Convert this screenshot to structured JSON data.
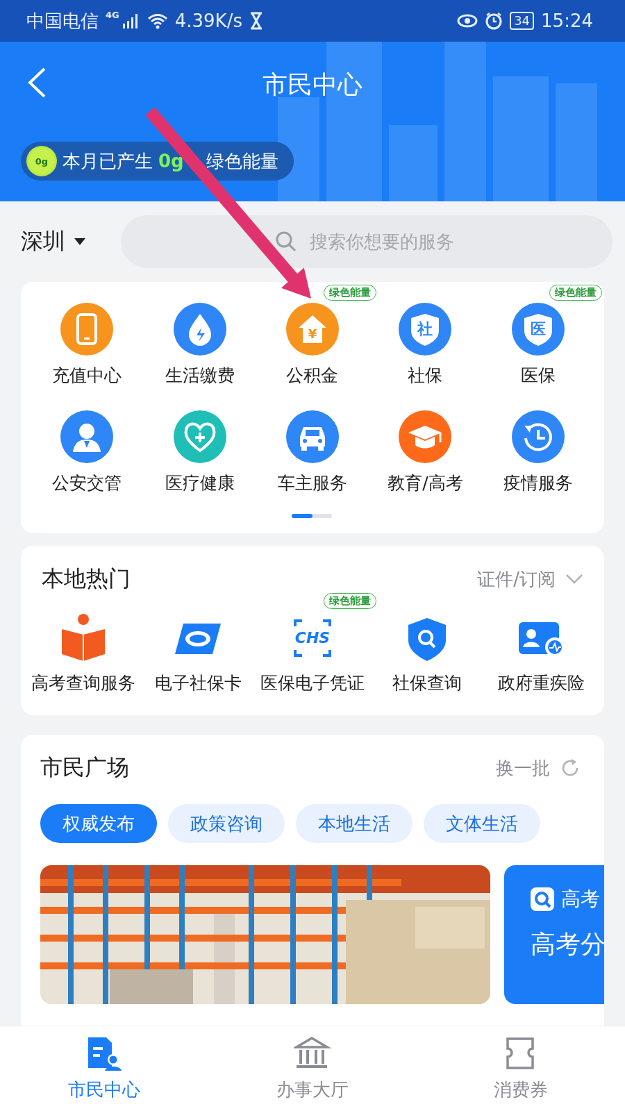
{
  "status_bar": {
    "carrier": "中国电信",
    "network": "4G",
    "speed": "4.39K/s",
    "battery": "34",
    "time": "15:24"
  },
  "header": {
    "title": "市民中心",
    "energy_badge": "0g",
    "energy_prefix": "本月已产生",
    "energy_amount": "0g",
    "energy_suffix": "绿色能量"
  },
  "city_selector": {
    "label": "深圳"
  },
  "search": {
    "placeholder": "搜索你想要的服务"
  },
  "services": [
    {
      "label": "充值中心",
      "color": "#f7941d"
    },
    {
      "label": "生活缴费",
      "color": "#2f86f6"
    },
    {
      "label": "公积金",
      "color": "#f7941d",
      "icon_text": "¥",
      "tag": "绿色能量"
    },
    {
      "label": "社保",
      "color": "#2f86f6",
      "icon_text": "社"
    },
    {
      "label": "医保",
      "color": "#2f86f6",
      "icon_text": "医",
      "tag": "绿色能量"
    },
    {
      "label": "公安交管",
      "color": "#2f86f6"
    },
    {
      "label": "医疗健康",
      "color": "#1fbfb8"
    },
    {
      "label": "车主服务",
      "color": "#2f86f6"
    },
    {
      "label": "教育/高考",
      "color": "#ff6a1a"
    },
    {
      "label": "疫情服务",
      "color": "#2f86f6"
    }
  ],
  "local_hot": {
    "title": "本地热门",
    "link": "证件/订阅",
    "items": [
      {
        "label": "高考查询服务"
      },
      {
        "label": "电子社保卡"
      },
      {
        "label": "医保电子凭证",
        "icon_text": "CHS",
        "tag": "绿色能量"
      },
      {
        "label": "社保查询"
      },
      {
        "label": "政府重疾险"
      }
    ]
  },
  "plaza": {
    "title": "市民广场",
    "refresh": "换一批",
    "tabs": [
      {
        "label": "权威发布",
        "selected": true
      },
      {
        "label": "政策咨询",
        "selected": false
      },
      {
        "label": "本地生活",
        "selected": false
      },
      {
        "label": "文体生活",
        "selected": false
      }
    ],
    "side_card": {
      "tag": "高考",
      "headline": "高考分"
    }
  },
  "bottom_nav": [
    {
      "label": "市民中心",
      "selected": true
    },
    {
      "label": "办事大厅",
      "selected": false
    },
    {
      "label": "消费券",
      "selected": false
    }
  ]
}
